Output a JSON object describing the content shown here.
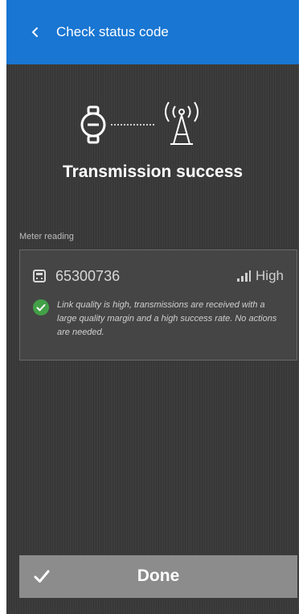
{
  "header": {
    "title": "Check status code",
    "back_icon": "chevron-left-icon",
    "color": "#1976d2"
  },
  "illustration": {
    "left_icon": "meter-icon",
    "right_icon": "antenna-icon"
  },
  "status": {
    "title": "Transmission success"
  },
  "meter_section": {
    "label": "Meter reading",
    "meter_icon": "meter-device-icon",
    "meter_id": "65300736",
    "signal_icon": "signal-bars-icon",
    "quality": "High",
    "message_icon": "check-circle-icon",
    "message": "Link quality is high, transmissions are received with a large quality margin and a high success rate. No actions are needed.",
    "success_color": "#43a047"
  },
  "footer": {
    "done_label": "Done",
    "done_icon": "checkmark-icon"
  }
}
